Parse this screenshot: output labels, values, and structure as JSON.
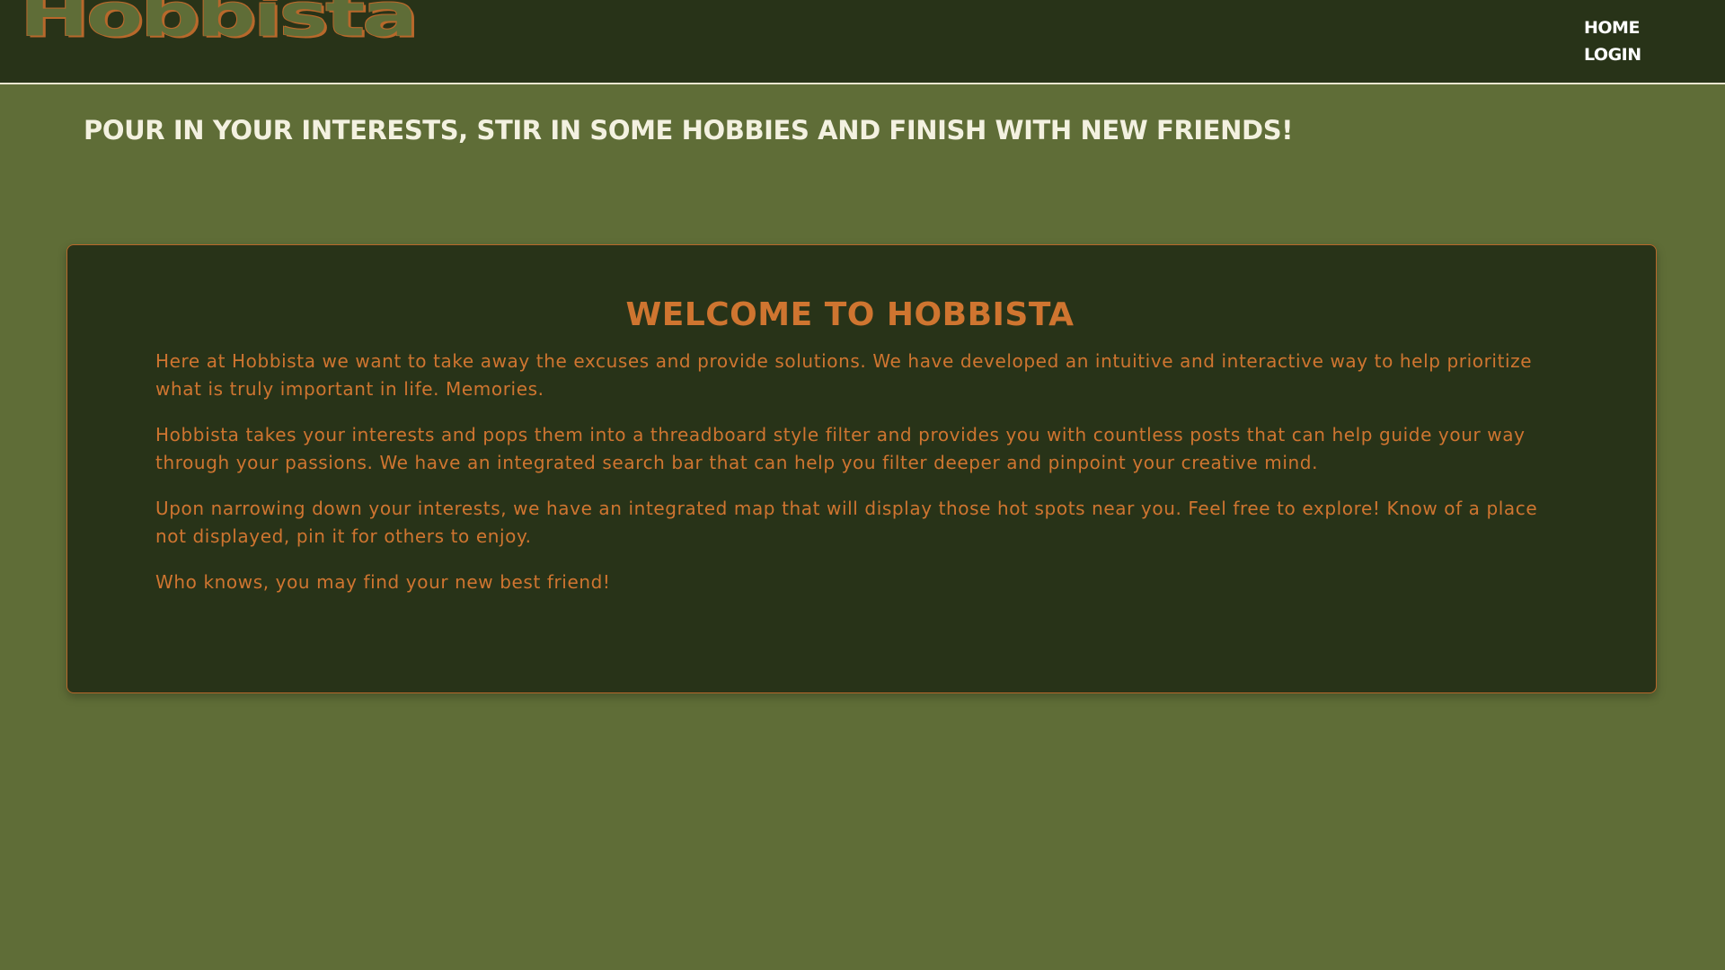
{
  "header": {
    "logo_text": "Hobbista",
    "nav": {
      "home_label": "HOME",
      "login_label": "LOGIN"
    }
  },
  "tagline": "POUR IN YOUR INTERESTS, STIR IN SOME HOBBIES AND FINISH WITH NEW FRIENDS!",
  "welcome": {
    "title": "WELCOME TO HOBBISTA",
    "paragraphs": [
      "Here at Hobbista we want to take away the excuses and provide solutions. We have developed an intuitive and interactive way to help prioritize what is truly important in life. Memories.",
      "Hobbista takes your interests and pops them into a threadboard style filter and provides you with countless posts that can help guide your way through your passions. We have an integrated search bar that can help you filter deeper and pinpoint your creative mind.",
      "Upon narrowing down your interests, we have an integrated map that will display those hot spots near you. Feel free to explore! Know of a place not displayed, pin it for others to enjoy.",
      "Who knows, you may find your new best friend!"
    ]
  },
  "colors": {
    "background": "#5f6d37",
    "header_bg": "#283318",
    "card_bg": "#283318",
    "accent": "#cf7530",
    "nav_text": "#ffffff",
    "tagline_text": "#f3f1e0"
  }
}
